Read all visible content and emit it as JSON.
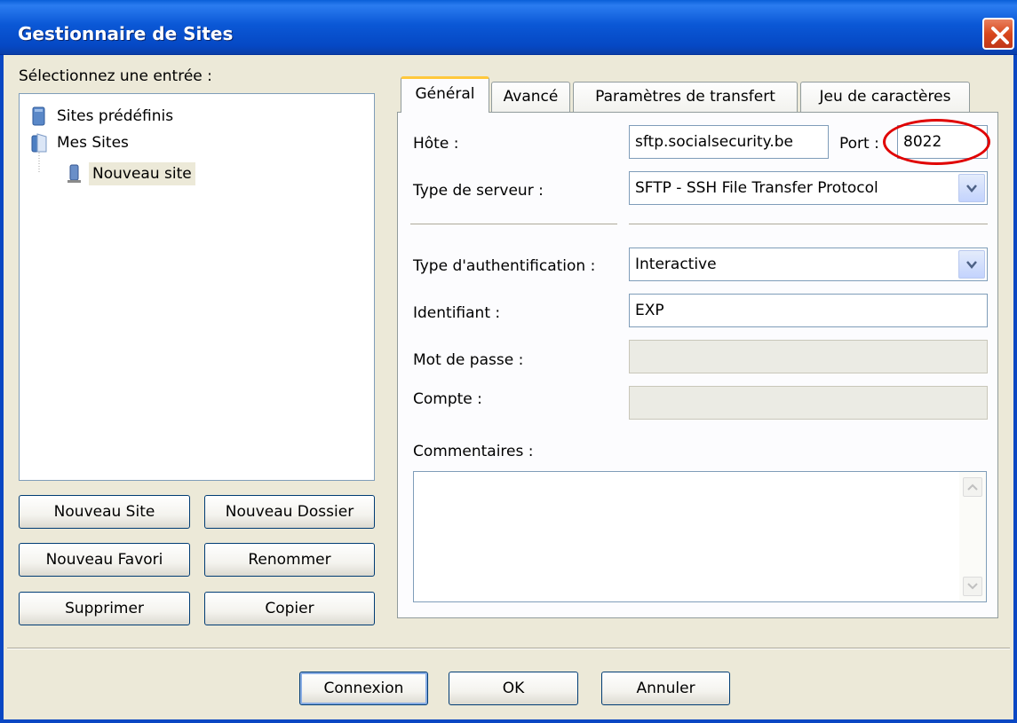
{
  "window": {
    "title": "Gestionnaire de Sites"
  },
  "left": {
    "select_label": "Sélectionnez une entrée :",
    "tree": [
      {
        "label": "Sites prédéfinis",
        "icon": "predefined-sites-icon"
      },
      {
        "label": "Mes Sites",
        "icon": "my-sites-icon"
      },
      {
        "label": "Nouveau site",
        "icon": "site-icon",
        "selected": true
      }
    ],
    "buttons": {
      "new_site": "Nouveau Site",
      "new_folder": "Nouveau Dossier",
      "new_favorite": "Nouveau Favori",
      "rename": "Renommer",
      "delete": "Supprimer",
      "copy": "Copier"
    }
  },
  "tabs": [
    "Général",
    "Avancé",
    "Paramètres de transfert",
    "Jeu de caractères"
  ],
  "general": {
    "host_label": "Hôte :",
    "host_value": "sftp.socialsecurity.be",
    "port_label": "Port :",
    "port_value": "8022",
    "server_type_label": "Type de serveur :",
    "server_type_value": "SFTP - SSH File Transfer Protocol",
    "auth_type_label": "Type d'authentification :",
    "auth_type_value": "Interactive",
    "login_label": "Identifiant :",
    "login_value": "EXP",
    "password_label": "Mot de passe :",
    "password_value": "",
    "account_label": "Compte :",
    "account_value": "",
    "comments_label": "Commentaires :",
    "comments_value": ""
  },
  "footer": {
    "connect": "Connexion",
    "ok": "OK",
    "cancel": "Annuler"
  },
  "colors": {
    "titlebar": "#0b58d6",
    "dialog_bg": "#ece9d8",
    "annotation": "#e00000",
    "active_tab_accent": "#ffc83c"
  }
}
